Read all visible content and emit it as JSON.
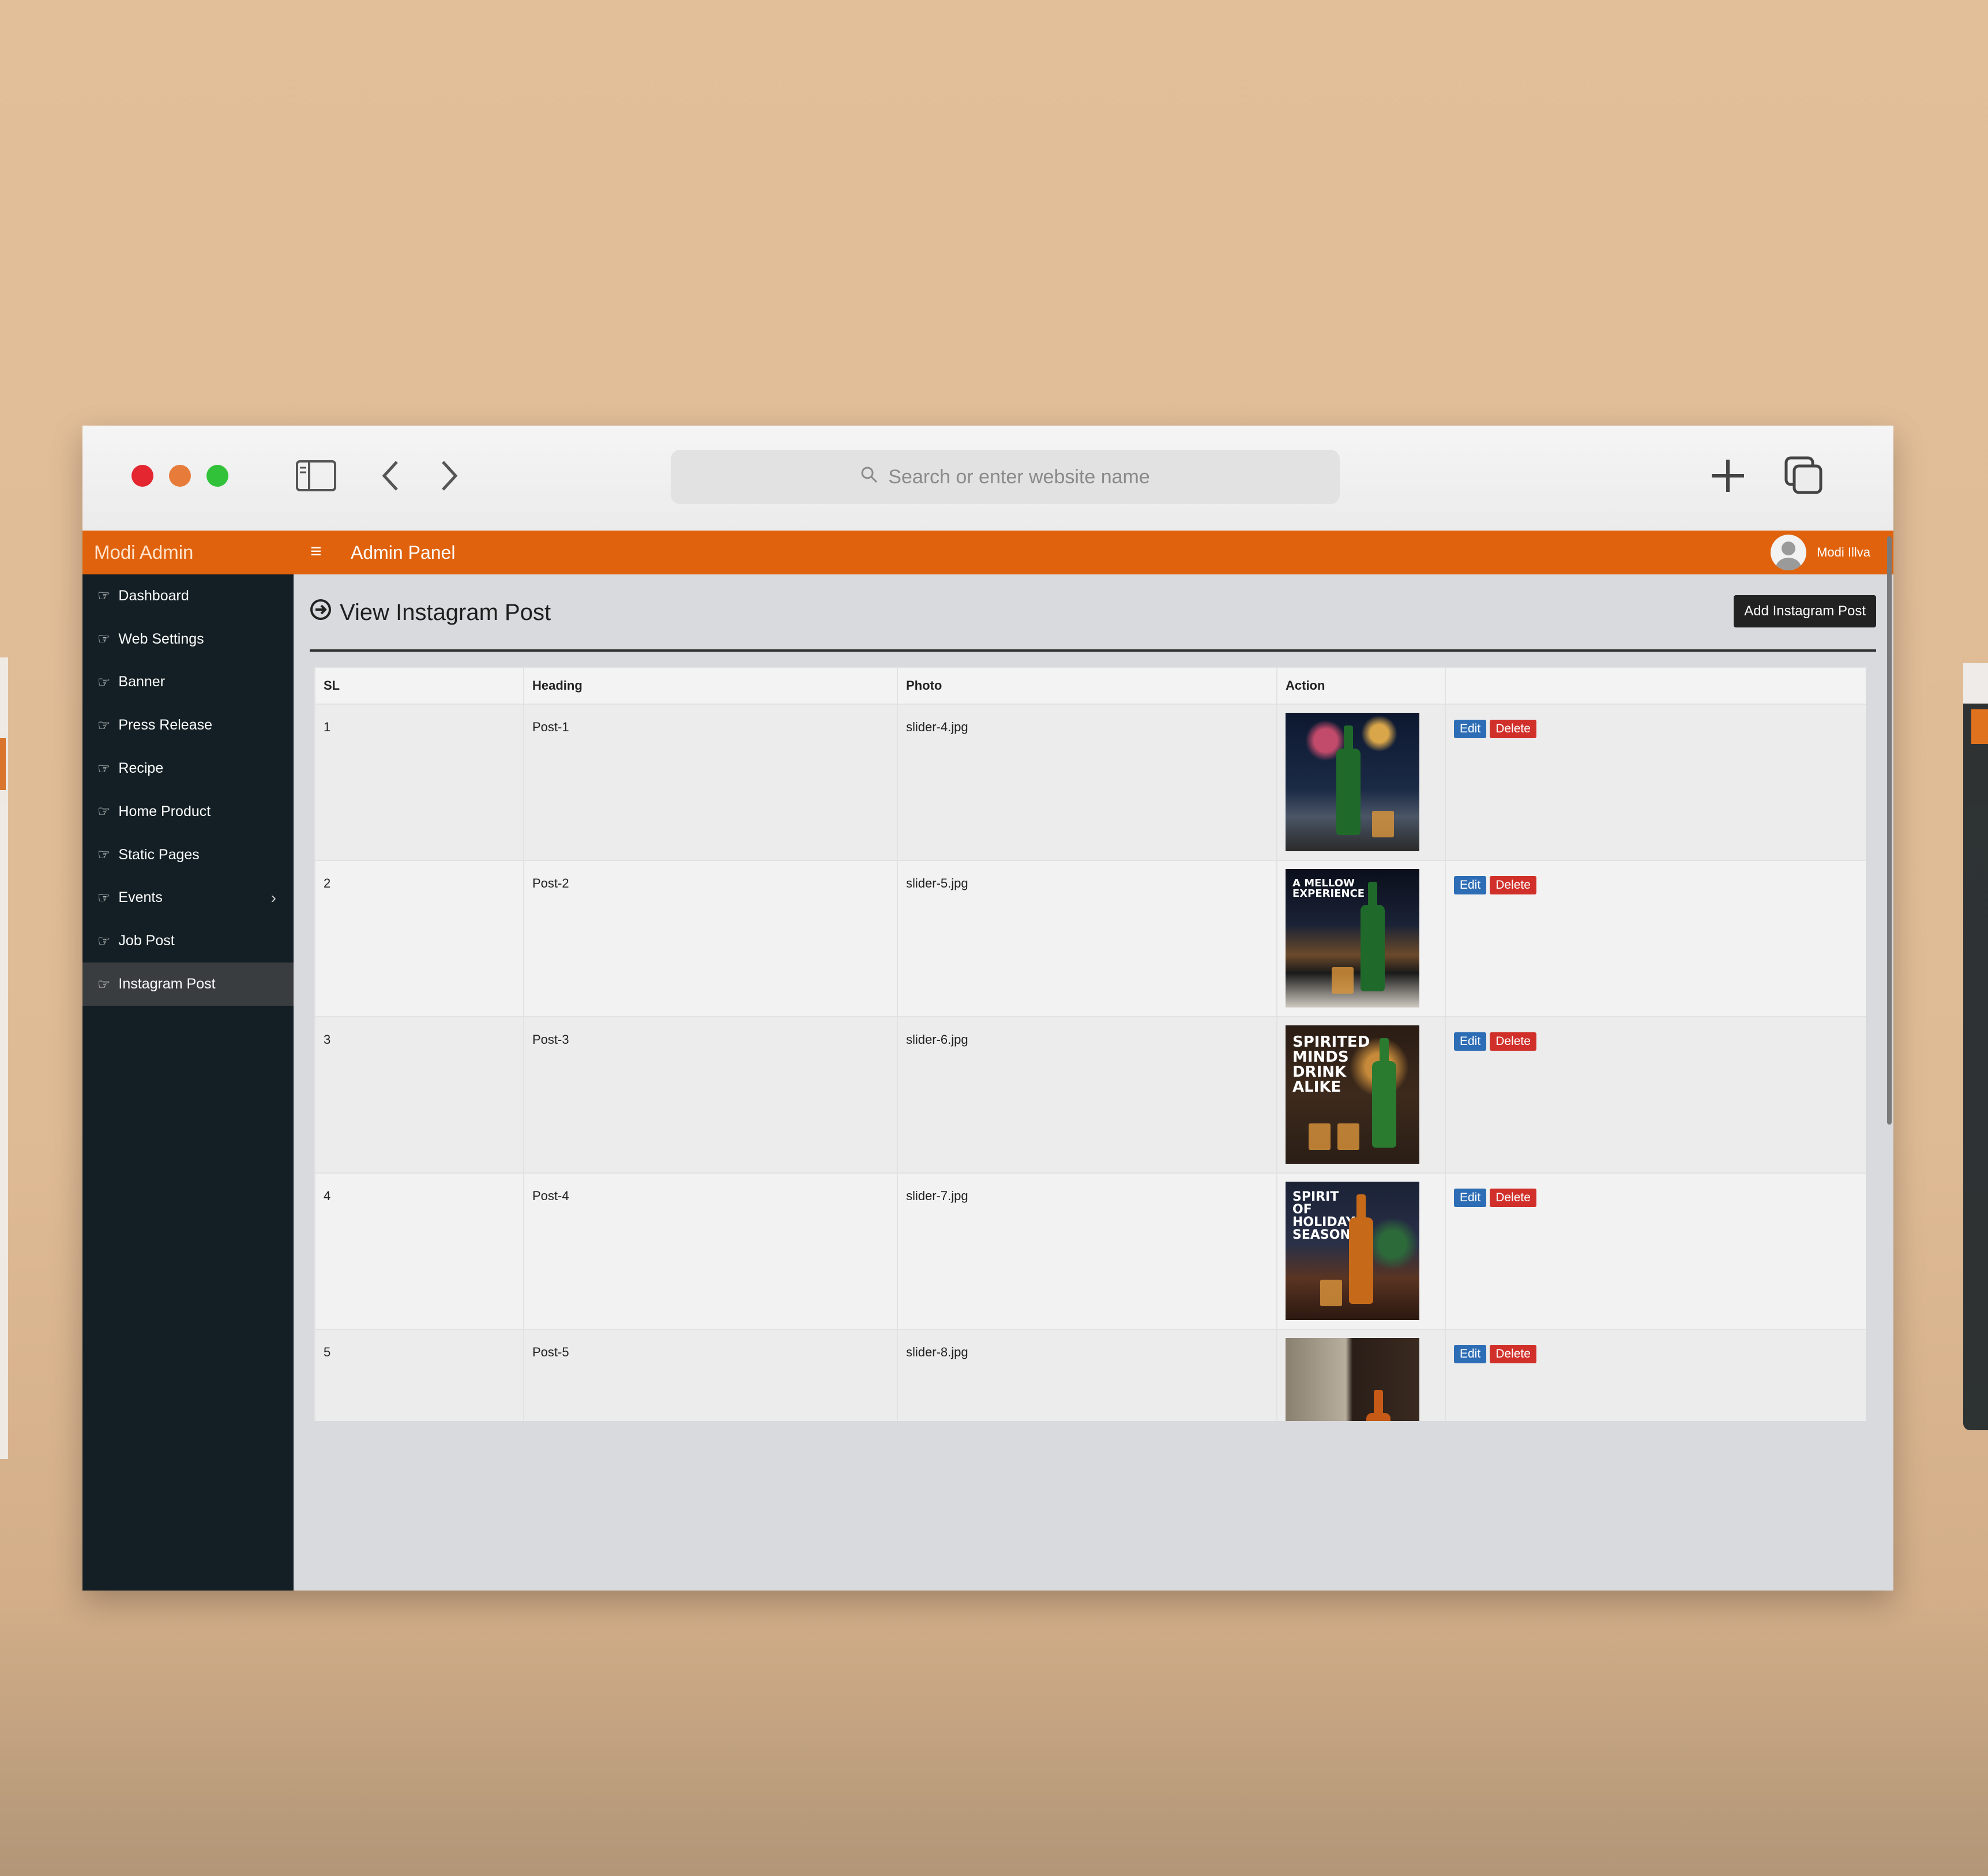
{
  "browser": {
    "search_placeholder": "Search or enter website name"
  },
  "topnav": {
    "brand": "Modi Admin",
    "panel_title": "Admin Panel",
    "user_name": "Modi Illva"
  },
  "sidebar": {
    "items": [
      {
        "label": "Dashboard"
      },
      {
        "label": "Web Settings"
      },
      {
        "label": "Banner"
      },
      {
        "label": "Press Release"
      },
      {
        "label": "Recipe"
      },
      {
        "label": "Home Product"
      },
      {
        "label": "Static Pages"
      },
      {
        "label": "Events"
      },
      {
        "label": "Job Post"
      },
      {
        "label": "Instagram Post"
      }
    ],
    "active": "Instagram Post"
  },
  "page": {
    "title": "View Instagram Post",
    "add_button": "Add Instagram Post"
  },
  "table": {
    "headers": [
      "SL",
      "Heading",
      "Photo",
      "Action"
    ],
    "rows": [
      {
        "sl": "1",
        "heading": "Post-1",
        "photo": "slider-4.jpg",
        "thumb_text": ""
      },
      {
        "sl": "2",
        "heading": "Post-2",
        "photo": "slider-5.jpg",
        "thumb_text": "A MELLOW EXPERIENCE"
      },
      {
        "sl": "3",
        "heading": "Post-3",
        "photo": "slider-6.jpg",
        "thumb_text": "SPIRITED MINDS DRINK ALIKE"
      },
      {
        "sl": "4",
        "heading": "Post-4",
        "photo": "slider-7.jpg",
        "thumb_text": "SPIRIT OF HOLIDAY SEASON"
      },
      {
        "sl": "5",
        "heading": "Post-5",
        "photo": "slider-8.jpg",
        "thumb_text": ""
      }
    ],
    "edit_label": "Edit",
    "delete_label": "Delete"
  },
  "colors": {
    "accent": "#e0620c",
    "sidebar_bg": "#131f24",
    "edit": "#2d6db5",
    "delete": "#d1302a"
  }
}
